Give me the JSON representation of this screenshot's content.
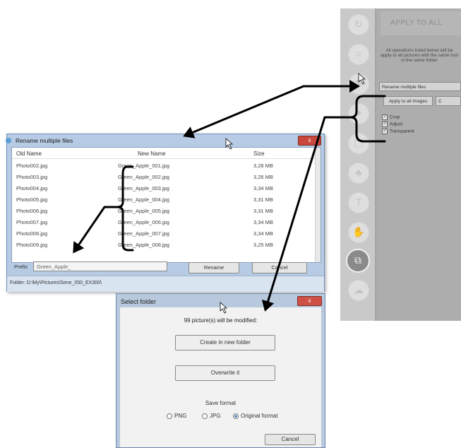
{
  "side_panel": {
    "apply_to_all": "APPLY TO ALL",
    "description": "All operations listed below will be apply to all pictures with the same tool in the same folder",
    "rename_multiple_button": "Rename multiple files",
    "apply_images_button": "Apply to all images",
    "checks": [
      {
        "label": "Crop",
        "checked": true
      },
      {
        "label": "Adjust",
        "checked": true
      },
      {
        "label": "Transparent",
        "checked": true
      }
    ],
    "icons": [
      "rotate-icon",
      "crop-icon",
      "adjust-icon",
      "effects-icon",
      "frame-icon",
      "stamp-icon",
      "text-icon",
      "hand-icon",
      "batch-icon",
      "cloud-icon"
    ]
  },
  "rename_dialog": {
    "title": "Rename multiple files",
    "close": "x",
    "columns": [
      "Old Name",
      "New Name",
      "Size"
    ],
    "rows": [
      [
        "Photo002.jpg",
        "Green_Apple_001.jpg",
        "3,28 MB"
      ],
      [
        "Photo003.jpg",
        "Green_Apple_002.jpg",
        "3,26 MB"
      ],
      [
        "Photo004.jpg",
        "Green_Apple_003.jpg",
        "3,34 MB"
      ],
      [
        "Photo005.jpg",
        "Green_Apple_004.jpg",
        "3,31 MB"
      ],
      [
        "Photo006.jpg",
        "Green_Apple_005.jpg",
        "3,31 MB"
      ],
      [
        "Photo007.jpg",
        "Green_Apple_006.jpg",
        "3,34 MB"
      ],
      [
        "Photo008.jpg",
        "Green_Apple_007.jpg",
        "3,34 MB"
      ],
      [
        "Photo009.jpg",
        "Green_Apple_008.jpg",
        "3,25 MB"
      ]
    ],
    "prefix_label": "Prefix",
    "prefix_value": "Green_Apple_",
    "rename_button": "Rename",
    "cancel_button": "Cancel",
    "folder_text": "Folder: D:\\My\\Pictures\\Sene_050_EX300\\"
  },
  "folder_dialog": {
    "title": "Select folder",
    "close": "x",
    "message": "99 picture(s) will be modified:",
    "new_folder_button": "Create in new folder",
    "overwrite_button": "Overwrite it",
    "format_label": "Save format",
    "formats": [
      {
        "label": "PNG",
        "selected": false
      },
      {
        "label": "JPG",
        "selected": false
      },
      {
        "label": "Original format",
        "selected": true
      }
    ],
    "cancel_button": "Cancel"
  }
}
